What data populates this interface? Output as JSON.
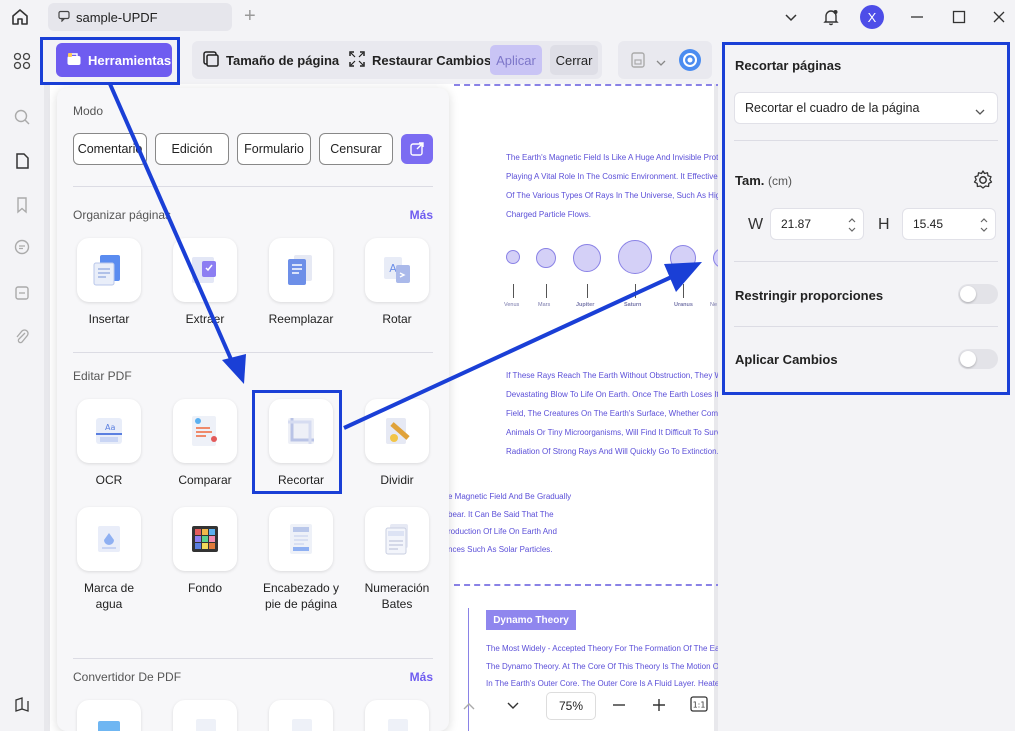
{
  "titlebar": {
    "tab_title": "sample-UPDF",
    "avatar_letter": "X"
  },
  "toolbar": {
    "tools_label": "Herramientas",
    "page_size_label": "Tamaño de página",
    "restore_label": "Restaurar Cambios",
    "apply_label": "Aplicar",
    "close_label": "Cerrar"
  },
  "popup": {
    "mode_title": "Modo",
    "modes": [
      "Comentario",
      "Edición",
      "Formulario",
      "Censurar"
    ],
    "organize_title": "Organizar páginas",
    "more_label": "Más",
    "organize_tools": [
      "Insertar",
      "Extraer",
      "Reemplazar",
      "Rotar"
    ],
    "edit_title": "Editar PDF",
    "edit_tools": [
      "OCR",
      "Comparar",
      "Recortar",
      "Dividir"
    ],
    "edit_tools_row2": [
      "Marca de agua",
      "Fondo",
      "Encabezado y pie de página",
      "Numeración Bates"
    ],
    "convert_title": "Convertidor De PDF"
  },
  "document": {
    "para1": [
      "The Earth's Magnetic Field Is Like A Huge And Invisible Prote",
      "Playing A Vital Role In The Cosmic Environment. It Effectivel",
      "Of The Various Types Of Rays In The Universe, Such As Hig",
      "Charged Particle Flows."
    ],
    "planets": [
      "Venus",
      "Mars",
      "Jupiter",
      "Saturn",
      "Uranus",
      "Ne"
    ],
    "para2": [
      "If These Rays Reach The Earth Without Obstruction, They W",
      "Devastating Blow To Life On Earth. Once The Earth Loses It",
      "Field, The Creatures On The Earth's Surface, Whether Comp",
      "Animals Or Tiny Microorganisms, Will Find It Difficult To Surv",
      "Radiation Of Strong Rays And Will Quickly Go To Extinction."
    ],
    "para3": [
      "e Magnetic Field And Be Gradually",
      "bear. It Can Be Said That The",
      "roduction Of Life On Earth And",
      "nces Such As Solar Particles."
    ],
    "section_tag": "Dynamo Theory",
    "para4": [
      "The Most Widely - Accepted Theory For The Formation Of The Ea",
      "The Dynamo Theory. At The Core Of This Theory Is The Motion O",
      "In The Earth's Outer Core. The Outer Core Is A Fluid Layer. Heate"
    ],
    "zoom": "75%"
  },
  "rpanel": {
    "title": "Recortar páginas",
    "crop_mode": "Recortar el cuadro de la página",
    "size_label": "Tam.",
    "size_unit": "(cm)",
    "w_label": "W",
    "w_value": "21.87",
    "h_label": "H",
    "h_value": "15.45",
    "restrict_label": "Restringir proporciones",
    "apply_label": "Aplicar Cambios"
  },
  "colors": {
    "accent": "#6f5cf0",
    "highlight": "#1a3fd6",
    "doc_text": "#5b4fd8"
  }
}
